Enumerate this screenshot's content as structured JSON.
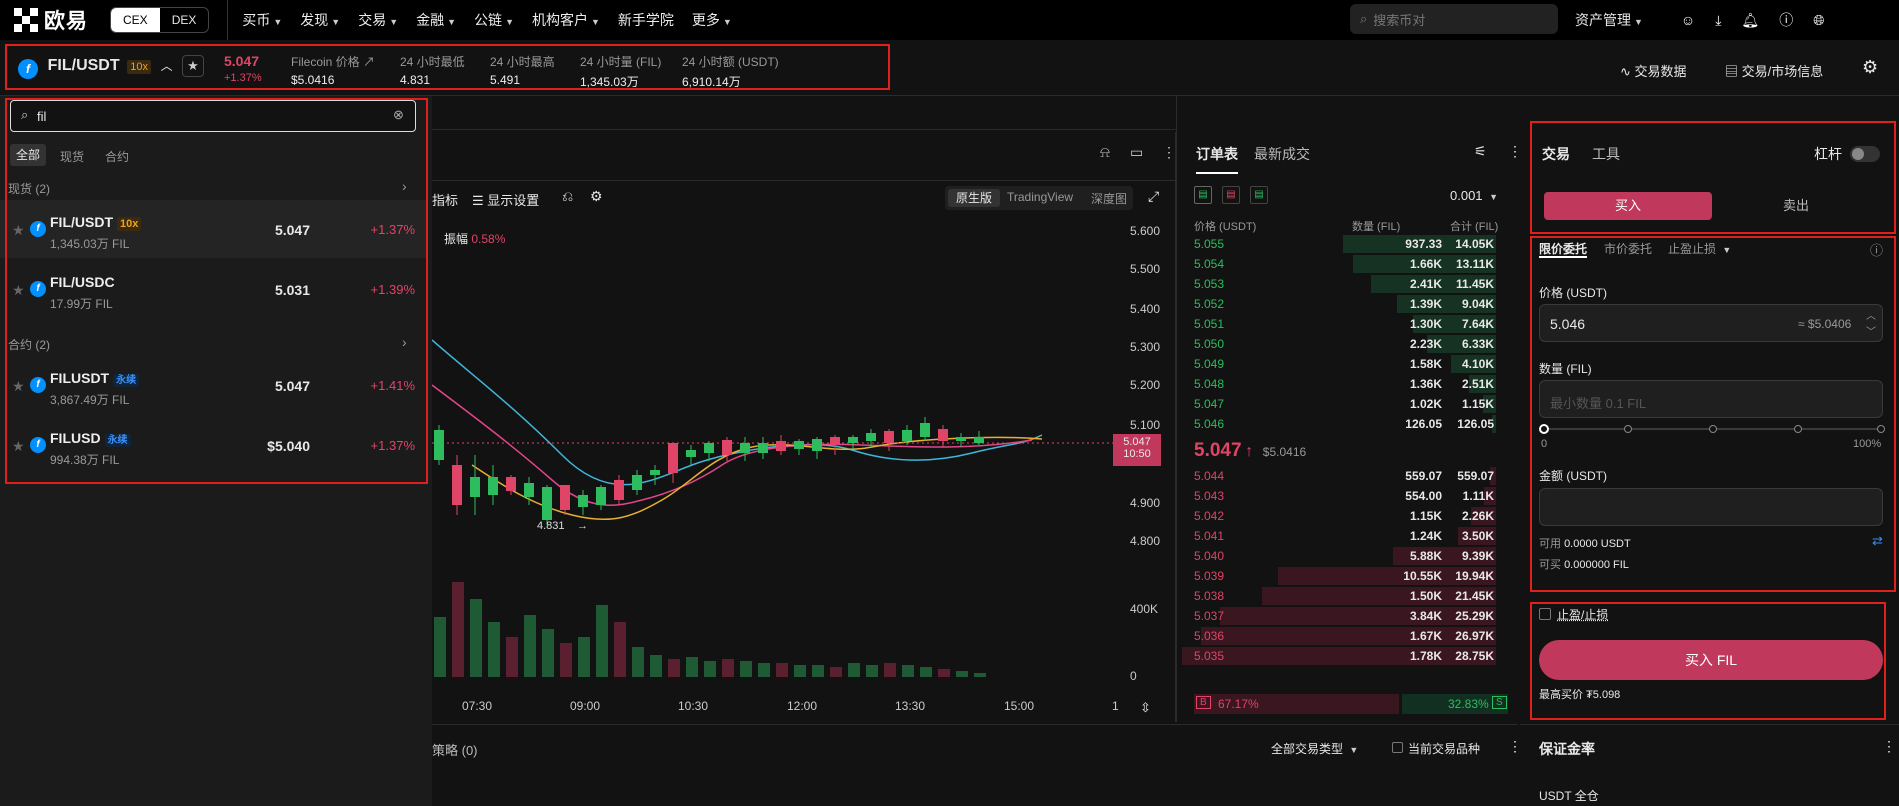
{
  "nav": {
    "brand": "欧易",
    "cex": "CEX",
    "dex": "DEX",
    "menu": [
      "买币",
      "发现",
      "交易",
      "金融",
      "公链",
      "机构客户",
      "新手学院",
      "更多"
    ],
    "search_placeholder": "搜索币对",
    "asset": "资产管理"
  },
  "ticker": {
    "pair": "FIL/USDT",
    "leverage": "10x",
    "price": "5.047",
    "change": "+1.37%",
    "stats": [
      {
        "label": "Filecoin 价格",
        "value": "$5.0416"
      },
      {
        "label": "24 小时最低",
        "value": "4.831"
      },
      {
        "label": "24 小时最高",
        "value": "5.491"
      },
      {
        "label": "24 小时量 (FIL)",
        "value": "1,345.03万"
      },
      {
        "label": "24 小时额 (USDT)",
        "value": "6,910.14万"
      }
    ],
    "links": [
      "交易数据",
      "交易/市场信息"
    ]
  },
  "dropdown": {
    "search_value": "fil",
    "tabs": [
      "全部",
      "现货",
      "合约"
    ],
    "spot_header": "现货 (2)",
    "contract_header": "合约 (2)",
    "spot": [
      {
        "name": "FIL/USDT",
        "badge": "10x",
        "vol": "1,345.03万 FIL",
        "price": "5.047",
        "change": "+1.37%"
      },
      {
        "name": "FIL/USDC",
        "badge": "",
        "vol": "17.99万 FIL",
        "price": "5.031",
        "change": "+1.39%"
      }
    ],
    "contract": [
      {
        "name": "FILUSDT",
        "badge": "永续",
        "vol": "3,867.49万 FIL",
        "price": "5.047",
        "change": "+1.41%"
      },
      {
        "name": "FILUSD",
        "badge": "永续",
        "vol": "994.38万 FIL",
        "price": "$5.040",
        "change": "+1.37%"
      }
    ]
  },
  "chart": {
    "indicators": "指标",
    "display": "显示设置",
    "modes": [
      "原生版",
      "TradingView",
      "深度图"
    ],
    "amplitude_label": "振幅",
    "amplitude": "0.58%",
    "y_ticks": [
      "5.600",
      "5.500",
      "5.400",
      "5.300",
      "5.200",
      "5.100",
      "4.900",
      "4.800"
    ],
    "vol_ticks": [
      "400K",
      "0"
    ],
    "x_ticks": [
      "07:30",
      "09:00",
      "10:30",
      "12:00",
      "13:30",
      "15:00",
      "1"
    ],
    "last_price": "5.047",
    "countdown": "10:50",
    "low_label": "4.831"
  },
  "chart_data": {
    "type": "candlestick",
    "x": [
      "07:30",
      "09:00",
      "10:30",
      "12:00",
      "13:30",
      "15:00"
    ],
    "ylim": [
      4.75,
      5.65
    ],
    "last": 5.047,
    "low": 4.831
  },
  "orderbook": {
    "tabs": [
      "订单表",
      "最新成交"
    ],
    "precision": "0.001",
    "cols": [
      "价格 (USDT)",
      "数量 (FIL)",
      "合计 (FIL)"
    ],
    "asks": [
      [
        "5.055",
        "937.33",
        "14.05K"
      ],
      [
        "5.054",
        "1.66K",
        "13.11K"
      ],
      [
        "5.053",
        "2.41K",
        "11.45K"
      ],
      [
        "5.052",
        "1.39K",
        "9.04K"
      ],
      [
        "5.051",
        "1.30K",
        "7.64K"
      ],
      [
        "5.050",
        "2.23K",
        "6.33K"
      ],
      [
        "5.049",
        "1.58K",
        "4.10K"
      ],
      [
        "5.048",
        "1.36K",
        "2.51K"
      ],
      [
        "5.047",
        "1.02K",
        "1.15K"
      ],
      [
        "5.046",
        "126.05",
        "126.05"
      ]
    ],
    "mid_price": "5.047",
    "mid_fiat": "$5.0416",
    "bids": [
      [
        "5.044",
        "559.07",
        "559.07"
      ],
      [
        "5.043",
        "554.00",
        "1.11K"
      ],
      [
        "5.042",
        "1.15K",
        "2.26K"
      ],
      [
        "5.041",
        "1.24K",
        "3.50K"
      ],
      [
        "5.040",
        "5.88K",
        "9.39K"
      ],
      [
        "5.039",
        "10.55K",
        "19.94K"
      ],
      [
        "5.038",
        "1.50K",
        "21.45K"
      ],
      [
        "5.037",
        "3.84K",
        "25.29K"
      ],
      [
        "5.036",
        "1.67K",
        "26.97K"
      ],
      [
        "5.035",
        "1.78K",
        "28.75K"
      ]
    ],
    "buy_ratio": "67.17%",
    "sell_ratio": "32.83%",
    "b": "B",
    "s": "S"
  },
  "trade": {
    "tabs": [
      "交易",
      "工具"
    ],
    "leverage": "杠杆",
    "buy": "买入",
    "sell": "卖出",
    "order_types": [
      "限价委托",
      "市价委托",
      "止盈止损"
    ],
    "price_label": "价格 (USDT)",
    "price_value": "5.046",
    "price_fiat": "≈ $5.0406",
    "qty_label": "数量 (FIL)",
    "qty_placeholder": "最小数量 0.1 FIL",
    "slider_min": "0",
    "slider_max": "100%",
    "amount_label": "金额 (USDT)",
    "avail_label": "可用",
    "avail_value": "0.0000 USDT",
    "buyable_label": "可买",
    "buyable_value": "0.000000 FIL",
    "tpsl": "止盈/止损",
    "buy_btn": "买入 FIL",
    "max_buy": "最高买价 ₮5.098",
    "rate_title": "保证金率",
    "rate_sub": "USDT 全仓"
  },
  "bottom": {
    "strategy": "策略 (0)",
    "type": "全部交易类型",
    "current": "当前交易品种"
  }
}
